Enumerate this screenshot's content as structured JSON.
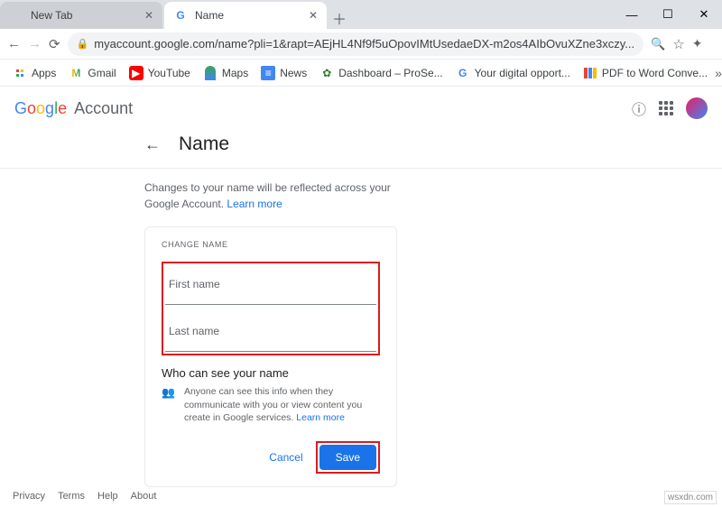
{
  "tabs": [
    {
      "title": "New Tab"
    },
    {
      "title": "Name"
    }
  ],
  "url": "myaccount.google.com/name?pli=1&rapt=AEjHL4Nf9f5uOpovIMtUsedaeDX-m2os4AIbOvuXZne3xczy...",
  "bookmarks": {
    "apps": "Apps",
    "gmail": "Gmail",
    "youtube": "YouTube",
    "maps": "Maps",
    "news": "News",
    "dashboard": "Dashboard – ProSe...",
    "digital": "Your digital opport...",
    "pdf": "PDF to Word Conve..."
  },
  "logo_account": "Account",
  "page_title": "Name",
  "subtitle_text": "Changes to your name will be reflected across your Google Account. ",
  "subtitle_link": "Learn more",
  "card": {
    "label": "CHANGE NAME",
    "first_name_label": "First name",
    "first_name_value": "",
    "last_name_label": "Last name",
    "last_name_value": "",
    "who_title": "Who can see your name",
    "who_body": "Anyone can see this info when they communicate with you or view content you create in Google services. ",
    "who_link": "Learn more",
    "cancel": "Cancel",
    "save": "Save"
  },
  "footer": {
    "privacy": "Privacy",
    "terms": "Terms",
    "help": "Help",
    "about": "About"
  },
  "watermark": "wsxdn.com"
}
